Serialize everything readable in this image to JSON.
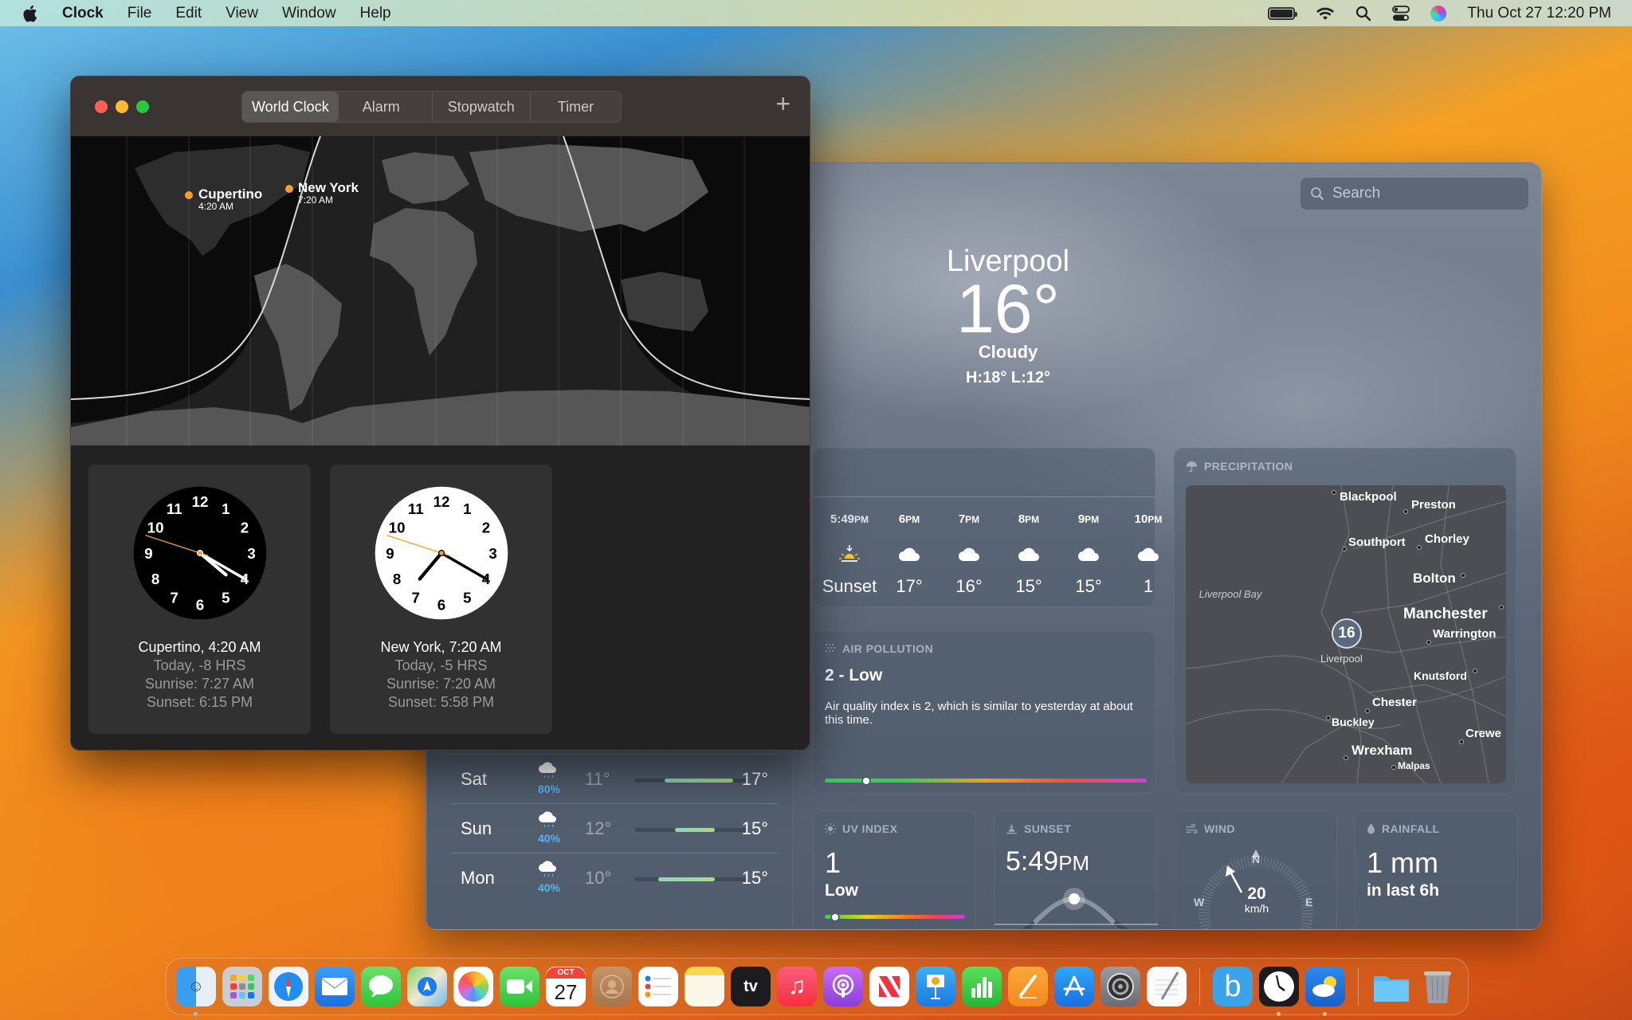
{
  "menubar": {
    "app_name": "Clock",
    "menus": [
      "File",
      "Edit",
      "View",
      "Window",
      "Help"
    ],
    "datetime": "Thu Oct 27  12:20 PM",
    "status_icons": [
      "battery-icon",
      "wifi-icon",
      "search-icon",
      "control-center-icon",
      "siri-icon"
    ]
  },
  "clock_window": {
    "tabs": [
      {
        "label": "World Clock",
        "active": true
      },
      {
        "label": "Alarm",
        "active": false
      },
      {
        "label": "Stopwatch",
        "active": false
      },
      {
        "label": "Timer",
        "active": false
      }
    ],
    "add_button": "+",
    "map_cities": [
      {
        "name": "Cupertino",
        "time": "4:20 AM"
      },
      {
        "name": "New York",
        "time": "7:20 AM"
      }
    ],
    "clocks": [
      {
        "title": "Cupertino, 4:20 AM",
        "offset": "Today, -8 HRS",
        "sunrise": "Sunrise: 7:27 AM",
        "sunset": "Sunset: 6:15 PM",
        "face": "dark",
        "hour": 4,
        "minute": 20,
        "second": 48
      },
      {
        "title": "New York, 7:20 AM",
        "offset": "Today, -5 HRS",
        "sunrise": "Sunrise: 7:20 AM",
        "sunset": "Sunset: 5:58 PM",
        "face": "light",
        "hour": 7,
        "minute": 20,
        "second": 48
      }
    ]
  },
  "weather_window": {
    "search_placeholder": "Search",
    "city": "Liverpool",
    "temperature": "16°",
    "condition": "Cloudy",
    "high_low": "H:18°  L:12°",
    "hourly": [
      {
        "time": "5:49",
        "suffix": "PM",
        "icon": "sunset-icon",
        "value": "Sunset"
      },
      {
        "time": "6",
        "suffix": "PM",
        "icon": "cloud-icon",
        "value": "17°"
      },
      {
        "time": "7",
        "suffix": "PM",
        "icon": "cloud-icon",
        "value": "16°"
      },
      {
        "time": "8",
        "suffix": "PM",
        "icon": "cloud-icon",
        "value": "15°"
      },
      {
        "time": "9",
        "suffix": "PM",
        "icon": "cloud-icon",
        "value": "15°"
      },
      {
        "time": "10",
        "suffix": "PM",
        "icon": "cloud-icon",
        "value": "1"
      }
    ],
    "air_pollution": {
      "title": "AIR POLLUTION",
      "value": "2 - Low",
      "description": "Air quality index is 2, which is similar to yesterday at about this time.",
      "level_fraction": 0.12
    },
    "precipitation": {
      "title": "PRECIPITATION",
      "water_label": "Liverpool Bay",
      "pin_value": "16",
      "pin_label": "Liverpool",
      "places": [
        "Blackpool",
        "Preston",
        "Southport",
        "Chorley",
        "Bolton",
        "Manchester",
        "Warrington",
        "Knutsford",
        "Chester",
        "Buckley",
        "Crewe",
        "Wrexham",
        "Malpas"
      ]
    },
    "uv_index": {
      "title": "UV INDEX",
      "value": "1",
      "label": "Low",
      "level_fraction": 0.05
    },
    "sunset": {
      "title": "SUNSET",
      "time": "5:49",
      "suffix": "PM"
    },
    "wind": {
      "title": "WIND",
      "speed": "20",
      "unit": "km/h",
      "directions": [
        "N",
        "W",
        "E"
      ]
    },
    "rainfall": {
      "title": "RAINFALL",
      "value": "1 mm",
      "label": "in last 6h"
    },
    "daily": [
      {
        "day": "Sat",
        "precip": "80%",
        "low": "11°",
        "high": "17°",
        "range": [
          0.27,
          0.87
        ]
      },
      {
        "day": "Sun",
        "precip": "40%",
        "low": "12°",
        "high": "15°",
        "range": [
          0.36,
          0.71
        ]
      },
      {
        "day": "Mon",
        "precip": "40%",
        "low": "10°",
        "high": "15°",
        "range": [
          0.21,
          0.71
        ]
      }
    ]
  },
  "dock": {
    "apps": [
      "Finder",
      "Launchpad",
      "Safari",
      "Mail",
      "Messages",
      "Maps",
      "Photos",
      "FaceTime",
      "Calendar",
      "Contacts",
      "Reminders",
      "Notes",
      "TV",
      "Music",
      "Podcasts",
      "News",
      "Keynote",
      "Numbers",
      "Pages",
      "App Store",
      "System Settings",
      "TextEdit",
      "Bluetooth App",
      "Clock",
      "Weather",
      "Downloads",
      "Trash"
    ],
    "calendar_month": "OCT",
    "calendar_day": "27",
    "tv_label": "tv"
  }
}
